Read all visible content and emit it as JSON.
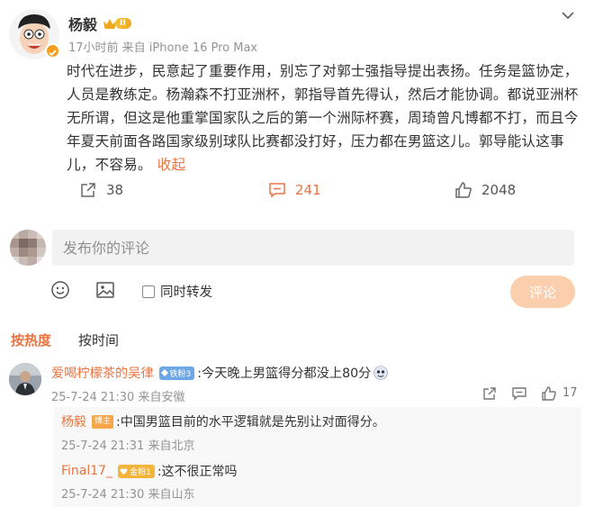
{
  "post": {
    "author": "杨毅",
    "vip_level": "II",
    "meta": "17小时前 来自 iPhone 16 Pro Max",
    "content_lines": [
      "时代在进步，民意起了重要作用，别忘了对郭士强指导提出表扬。任务是篮协定，",
      "人员是教练定。杨瀚森不打亚洲杯，郭指导首先得认，然后才能协调。都说亚洲杯",
      "无所谓，但这是他重掌国家队之后的第一个洲际杯赛，周琦曾凡博都不打，而且今",
      "年夏天前面各路国家级别球队比赛都没打好，压力都在男篮这儿。郭导能认这事",
      "儿，不容易。"
    ],
    "collapse_label": "收起",
    "reposts": "38",
    "comments": "241",
    "likes": "2048"
  },
  "composer": {
    "placeholder": "发布你的评论",
    "repost_label": "同时转发",
    "submit_label": "评论"
  },
  "sort": {
    "hot_label": "按热度",
    "time_label": "按时间"
  },
  "comment1": {
    "user": "爱喝柠檬茶的吴律",
    "badge": "铁粉3",
    "text": ":今天晚上男篮得分都没上80分",
    "meta": "25-7-24 21:30 来自安徽",
    "likes": "17"
  },
  "replies": [
    {
      "user": "杨毅",
      "tag": "博主",
      "text": ":中国男篮目前的水平逻辑就是先别让对面得分。",
      "meta": "25-7-24 21:31 来自北京"
    },
    {
      "user": "Final17_",
      "badge": "金粉1",
      "text": ":这不很正常吗",
      "meta": "25-7-24 21:30 来自山东"
    }
  ],
  "colors": {
    "accent": "#eb7340",
    "muted": "#939393",
    "submit_bg": "#fbcfae"
  }
}
